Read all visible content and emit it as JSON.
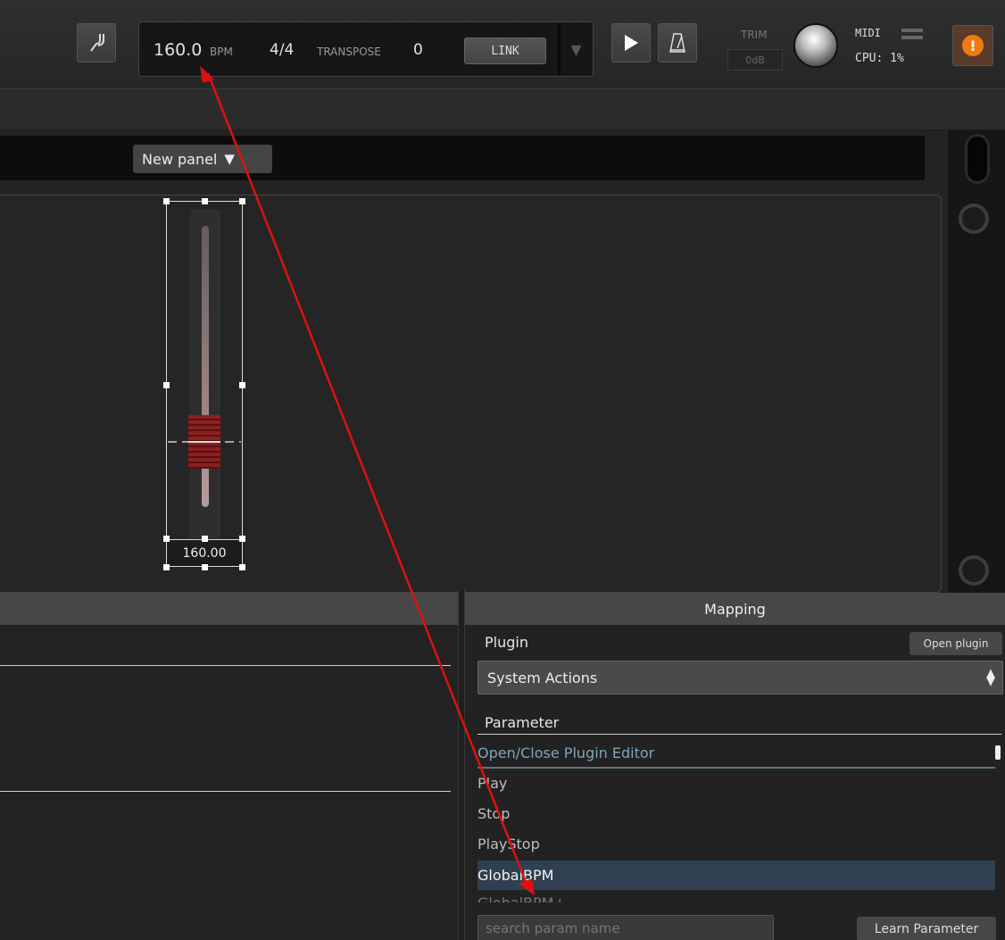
{
  "transport": {
    "bpm_value": "160.0",
    "bpm_unit": "BPM",
    "time_signature": "4/4",
    "transpose_label": "TRANSPOSE",
    "transpose_value": "0",
    "link_label": "LINK",
    "trim_label": "TRIM",
    "trim_value": "0dB",
    "midi_label": "MIDI",
    "cpu_label": "CPU: 1%"
  },
  "panel": {
    "new_panel_label": "New panel"
  },
  "slider": {
    "value_text": "160.00"
  },
  "mapping": {
    "title": "Mapping",
    "plugin_label": "Plugin",
    "open_plugin_label": "Open plugin",
    "plugin_selected": "System Actions",
    "parameter_label": "Parameter",
    "parameters": [
      "Open/Close Plugin Editor",
      "Play",
      "Stop",
      "PlayStop",
      "GlobalBPM",
      "GlobalBPM+"
    ],
    "search_placeholder": "search param name",
    "learn_label": "Learn Parameter"
  },
  "colors": {
    "accent_arrow": "#e01010",
    "highlight_row": "#2f4050",
    "slider_knob": "#8a2020"
  }
}
